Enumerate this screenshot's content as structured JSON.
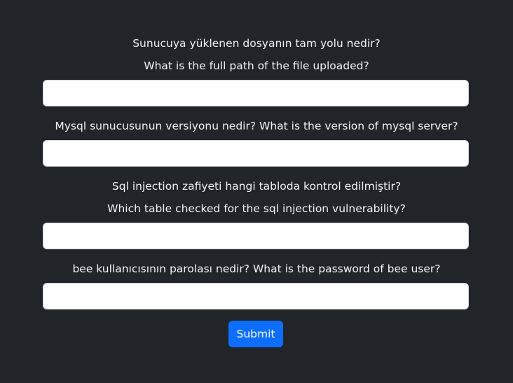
{
  "questions": [
    {
      "label_tr": "Sunucuya yüklenen dosyanın tam yolu nedir?",
      "label_en": "What is the full path of the file uploaded?",
      "value": ""
    },
    {
      "label": "Mysql sunucusunun versiyonu nedir? What is the version of mysql server?",
      "value": ""
    },
    {
      "label_tr": "Sql injection zafiyeti hangi tabloda kontrol edilmiştir?",
      "label_en": "Which table checked for the sql injection vulnerability?",
      "value": ""
    },
    {
      "label": "bee kullanıcısının parolası nedir? What is the password of bee user?",
      "value": ""
    }
  ],
  "submit_label": "Submit",
  "colors": {
    "background": "#212529",
    "text": "#f8f9fa",
    "button": "#0d6efd"
  }
}
